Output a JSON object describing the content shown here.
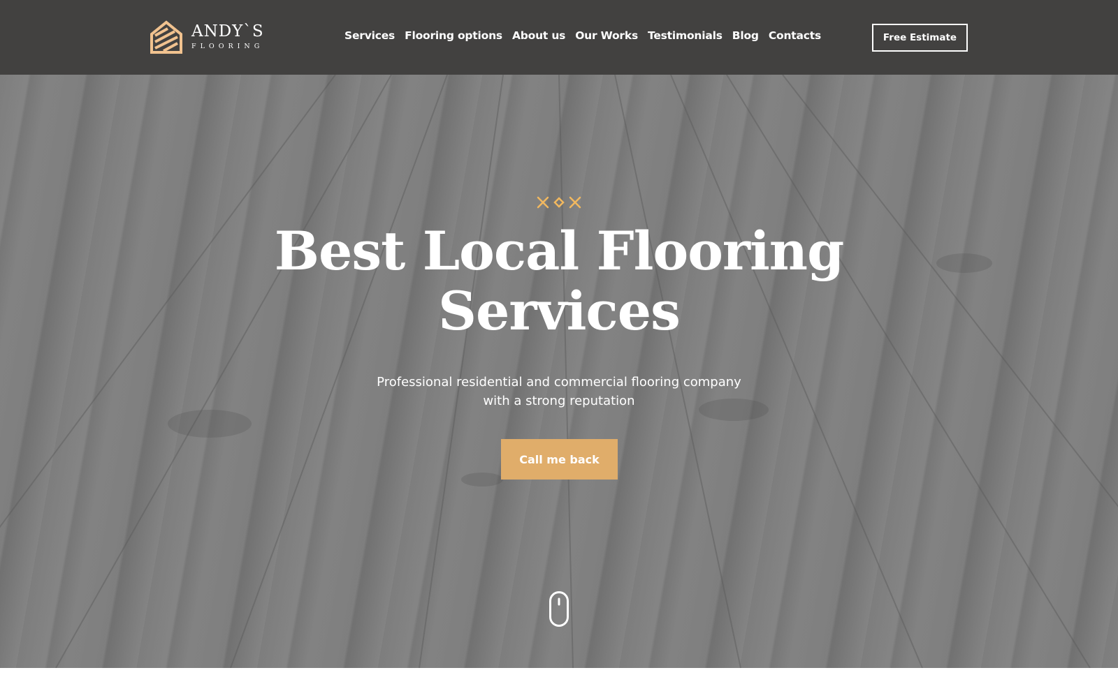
{
  "header": {
    "logo": {
      "name": "ANDY`S",
      "subtitle": "FLOORING",
      "icon": "house-stripes-logo-icon",
      "accent_color": "#f1c28f"
    },
    "nav": [
      {
        "label": "Services"
      },
      {
        "label": "Flooring options"
      },
      {
        "label": "About us"
      },
      {
        "label": "Our Works"
      },
      {
        "label": "Testimonials"
      },
      {
        "label": "Blog"
      },
      {
        "label": "Contacts"
      }
    ],
    "estimate_button": "Free Estimate",
    "background_color": "#424140"
  },
  "hero": {
    "ornament_icon": "cross-diamond-cross-ornament",
    "title_line1": "Best Local Flooring",
    "title_line2": "Services",
    "subtitle_line1": "Professional residential and commercial flooring company",
    "subtitle_line2": "with a strong reputation",
    "cta_button": "Call me back",
    "cta_color": "#e0ad6a",
    "scroll_icon": "mouse-scroll-icon"
  }
}
